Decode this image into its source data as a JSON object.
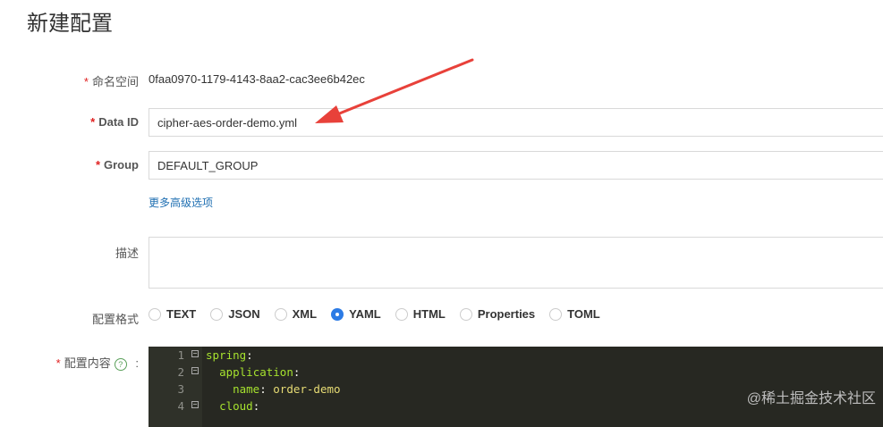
{
  "page": {
    "title": "新建配置"
  },
  "form": {
    "namespace": {
      "label": "命名空间",
      "value": "0faa0970-1179-4143-8aa2-cac3ee6b42ec"
    },
    "data_id": {
      "label": "Data ID",
      "value": "cipher-aes-order-demo.yml"
    },
    "group": {
      "label": "Group",
      "value": "DEFAULT_GROUP"
    },
    "advanced_link": "更多高级选项",
    "description": {
      "label": "描述",
      "value": ""
    },
    "format": {
      "label": "配置格式",
      "options": [
        "TEXT",
        "JSON",
        "XML",
        "YAML",
        "HTML",
        "Properties",
        "TOML"
      ],
      "selected": "YAML"
    },
    "content": {
      "label": "配置内容",
      "colon": ":"
    }
  },
  "required_mark": "*",
  "editor": {
    "lines": [
      {
        "num": "1",
        "key": "spring",
        "sep": ":",
        "val": ""
      },
      {
        "num": "2",
        "key": "application",
        "sep": ":",
        "val": ""
      },
      {
        "num": "3",
        "key": "name",
        "sep": ": ",
        "val": "order-demo"
      },
      {
        "num": "4",
        "key": "cloud",
        "sep": ":",
        "val": ""
      }
    ]
  },
  "watermark": "@稀土掘金技术社区",
  "colors": {
    "accent": "#2c7be5",
    "required": "#e02020",
    "link": "#1f6fb2",
    "editor_bg": "#272822",
    "arrow": "#e8413a"
  }
}
